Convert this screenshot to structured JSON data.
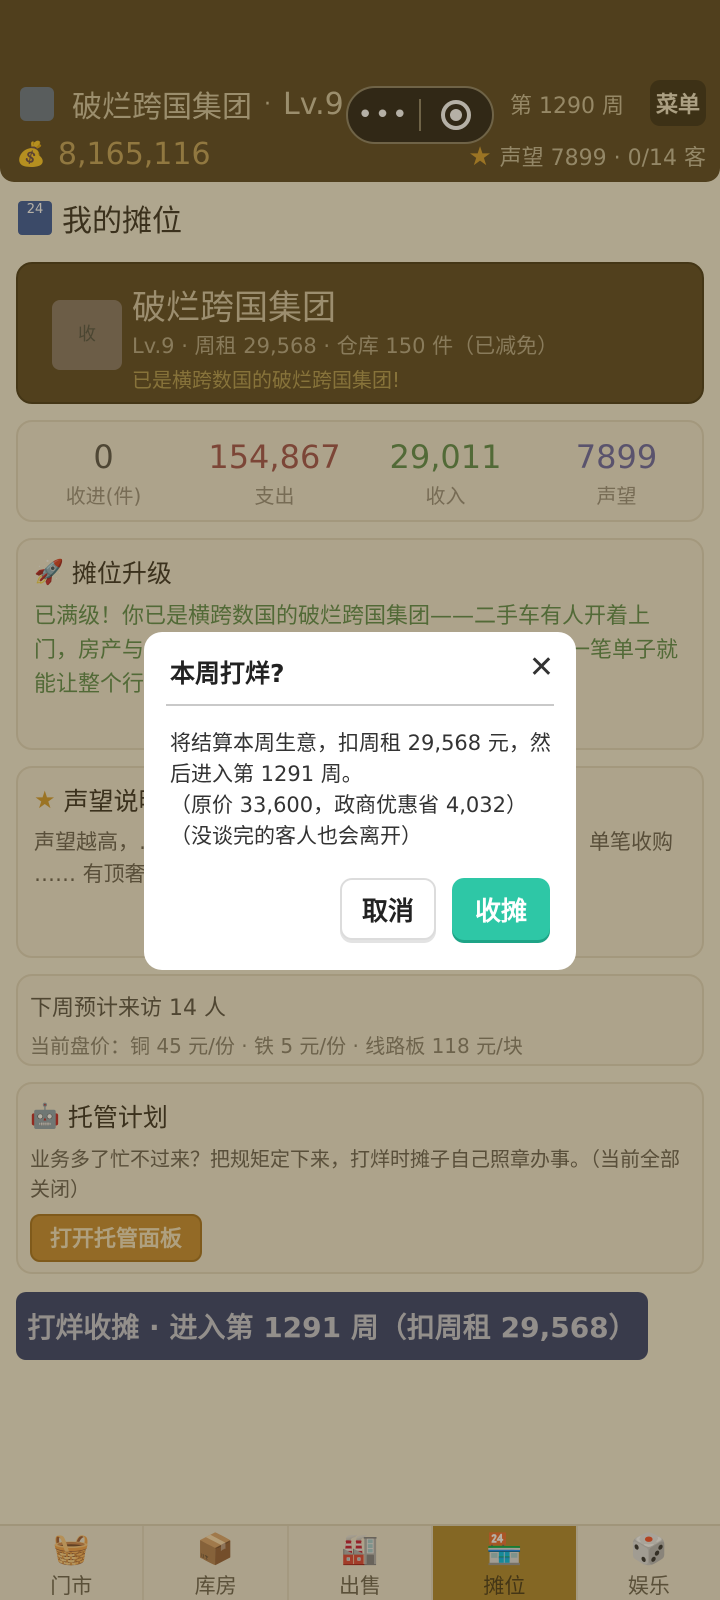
{
  "header": {
    "company": "破烂跨国集团",
    "level": "Lv.9",
    "week": "第 1290 周",
    "menu": "菜单",
    "money": "8,165,116",
    "reputation": "声望 7899",
    "customers": "· 0/14 客"
  },
  "section": {
    "title": "我的摊位",
    "icon_text": "24"
  },
  "profile": {
    "name": "破烂跨国集团",
    "sub": "Lv.9 · 周租 29,568 · 仓库 150 件（已减免）",
    "desc": "已是横跨数国的破烂跨国集团!",
    "image_text": "收"
  },
  "stats": [
    {
      "value": "0",
      "label": "收进(件)",
      "color": "#5b564a"
    },
    {
      "value": "154,867",
      "label": "支出",
      "color": "#a4554d"
    },
    {
      "value": "29,011",
      "label": "收入",
      "color": "#5f8e4c"
    },
    {
      "value": "7899",
      "label": "声望",
      "color": "#6c6aa3"
    }
  ],
  "upgrade": {
    "title": "摊位升级",
    "text": "已满级！你已是横跨数国的破烂跨国集团——二手车有人开着上门，房产与 ………… 顶签里每周还挂着法拍 ………… 一笔单子就能让整个行 ……"
  },
  "reputation_card": {
    "title": "声望说明",
    "text": "声望越高，…… 能解锁阔太、金老板、…… 进一件货 +1，单笔收购 …… 有顶奢大单能拿满。一……"
  },
  "visit": {
    "line1": "下周预计来访 14 人",
    "line2": "当前盘价：铜 45 元/份 · 铁 5 元/份 · 线路板 118 元/块"
  },
  "manage": {
    "title": "托管计划",
    "text": "业务多了忙不过来？把规矩定下来，打烊时摊子自己照章办事。（当前全部关闭）",
    "button": "打开托管面板"
  },
  "main_button": "打烊收摊 · 进入第 1291 周（扣周租 29,568）",
  "tabs": [
    {
      "icon": "🧺",
      "label": "门市"
    },
    {
      "icon": "📦",
      "label": "库房"
    },
    {
      "icon": "🏭",
      "label": "出售"
    },
    {
      "icon": "🏪",
      "label": "摊位"
    },
    {
      "icon": "🎲",
      "label": "娱乐"
    }
  ],
  "dialog": {
    "title": "本周打烊?",
    "close": "✕",
    "line1": "将结算本周生意，扣周租 29,568 元，然后进入第 1291 周。",
    "line2": "（原价 33,600，政商优惠省 4,032）",
    "line3": "（没谈完的客人也会离开）",
    "cancel": "取消",
    "confirm": "收摊"
  }
}
